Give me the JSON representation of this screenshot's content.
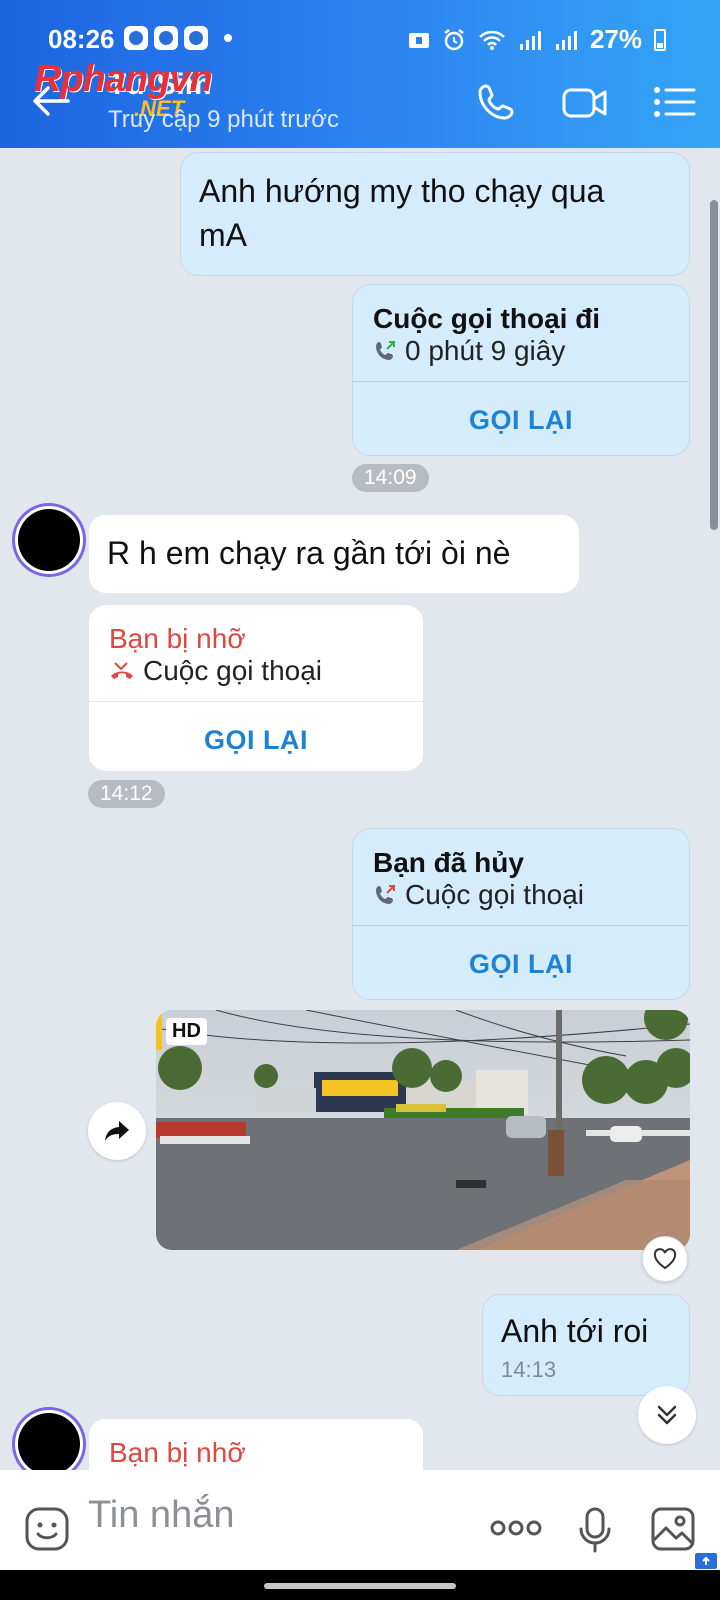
{
  "status_bar": {
    "time": "08:26",
    "battery": "27%"
  },
  "header": {
    "contact_name": "Tư Sim",
    "last_seen": "Truy cập 9 phút trước",
    "watermark": "Rphangvn",
    "watermark_suffix": ".NET",
    "icons": [
      "back-arrow-icon",
      "phone-icon",
      "video-call-icon",
      "menu-icon"
    ]
  },
  "messages": [
    {
      "type": "text",
      "side": "out",
      "text_line1": "Anh hướng my tho chạy qua",
      "text_line2": "mA"
    },
    {
      "type": "call",
      "side": "out",
      "title": "Cuộc gọi thoại đi",
      "subtitle": "0 phút 9 giây",
      "action": "GỌI LẠI"
    },
    {
      "type": "time",
      "label": "14:09"
    },
    {
      "type": "text",
      "side": "in",
      "text": "R h em chạy ra gần tới òi nè"
    },
    {
      "type": "call",
      "side": "in",
      "title": "Bạn bị nhỡ",
      "subtitle": "Cuộc gọi thoại",
      "action": "GỌI LẠI"
    },
    {
      "type": "time",
      "label": "14:12"
    },
    {
      "type": "call",
      "side": "out",
      "title": "Bạn đã hủy",
      "subtitle": "Cuộc gọi thoại",
      "action": "GỌI LẠI"
    },
    {
      "type": "image",
      "side": "out",
      "badge": "HD"
    },
    {
      "type": "text",
      "side": "out",
      "text": "Anh tới roi",
      "time": "14:13"
    },
    {
      "type": "call",
      "side": "in",
      "title": "Bạn bị nhỡ"
    }
  ],
  "input": {
    "placeholder": "Tin nhắn"
  },
  "colors": {
    "header_start": "#1d64e0",
    "header_end": "#35a5f6",
    "out_bubble": "#d4ecfc",
    "missed_red": "#e0473e",
    "action_blue": "#1b82d8"
  }
}
